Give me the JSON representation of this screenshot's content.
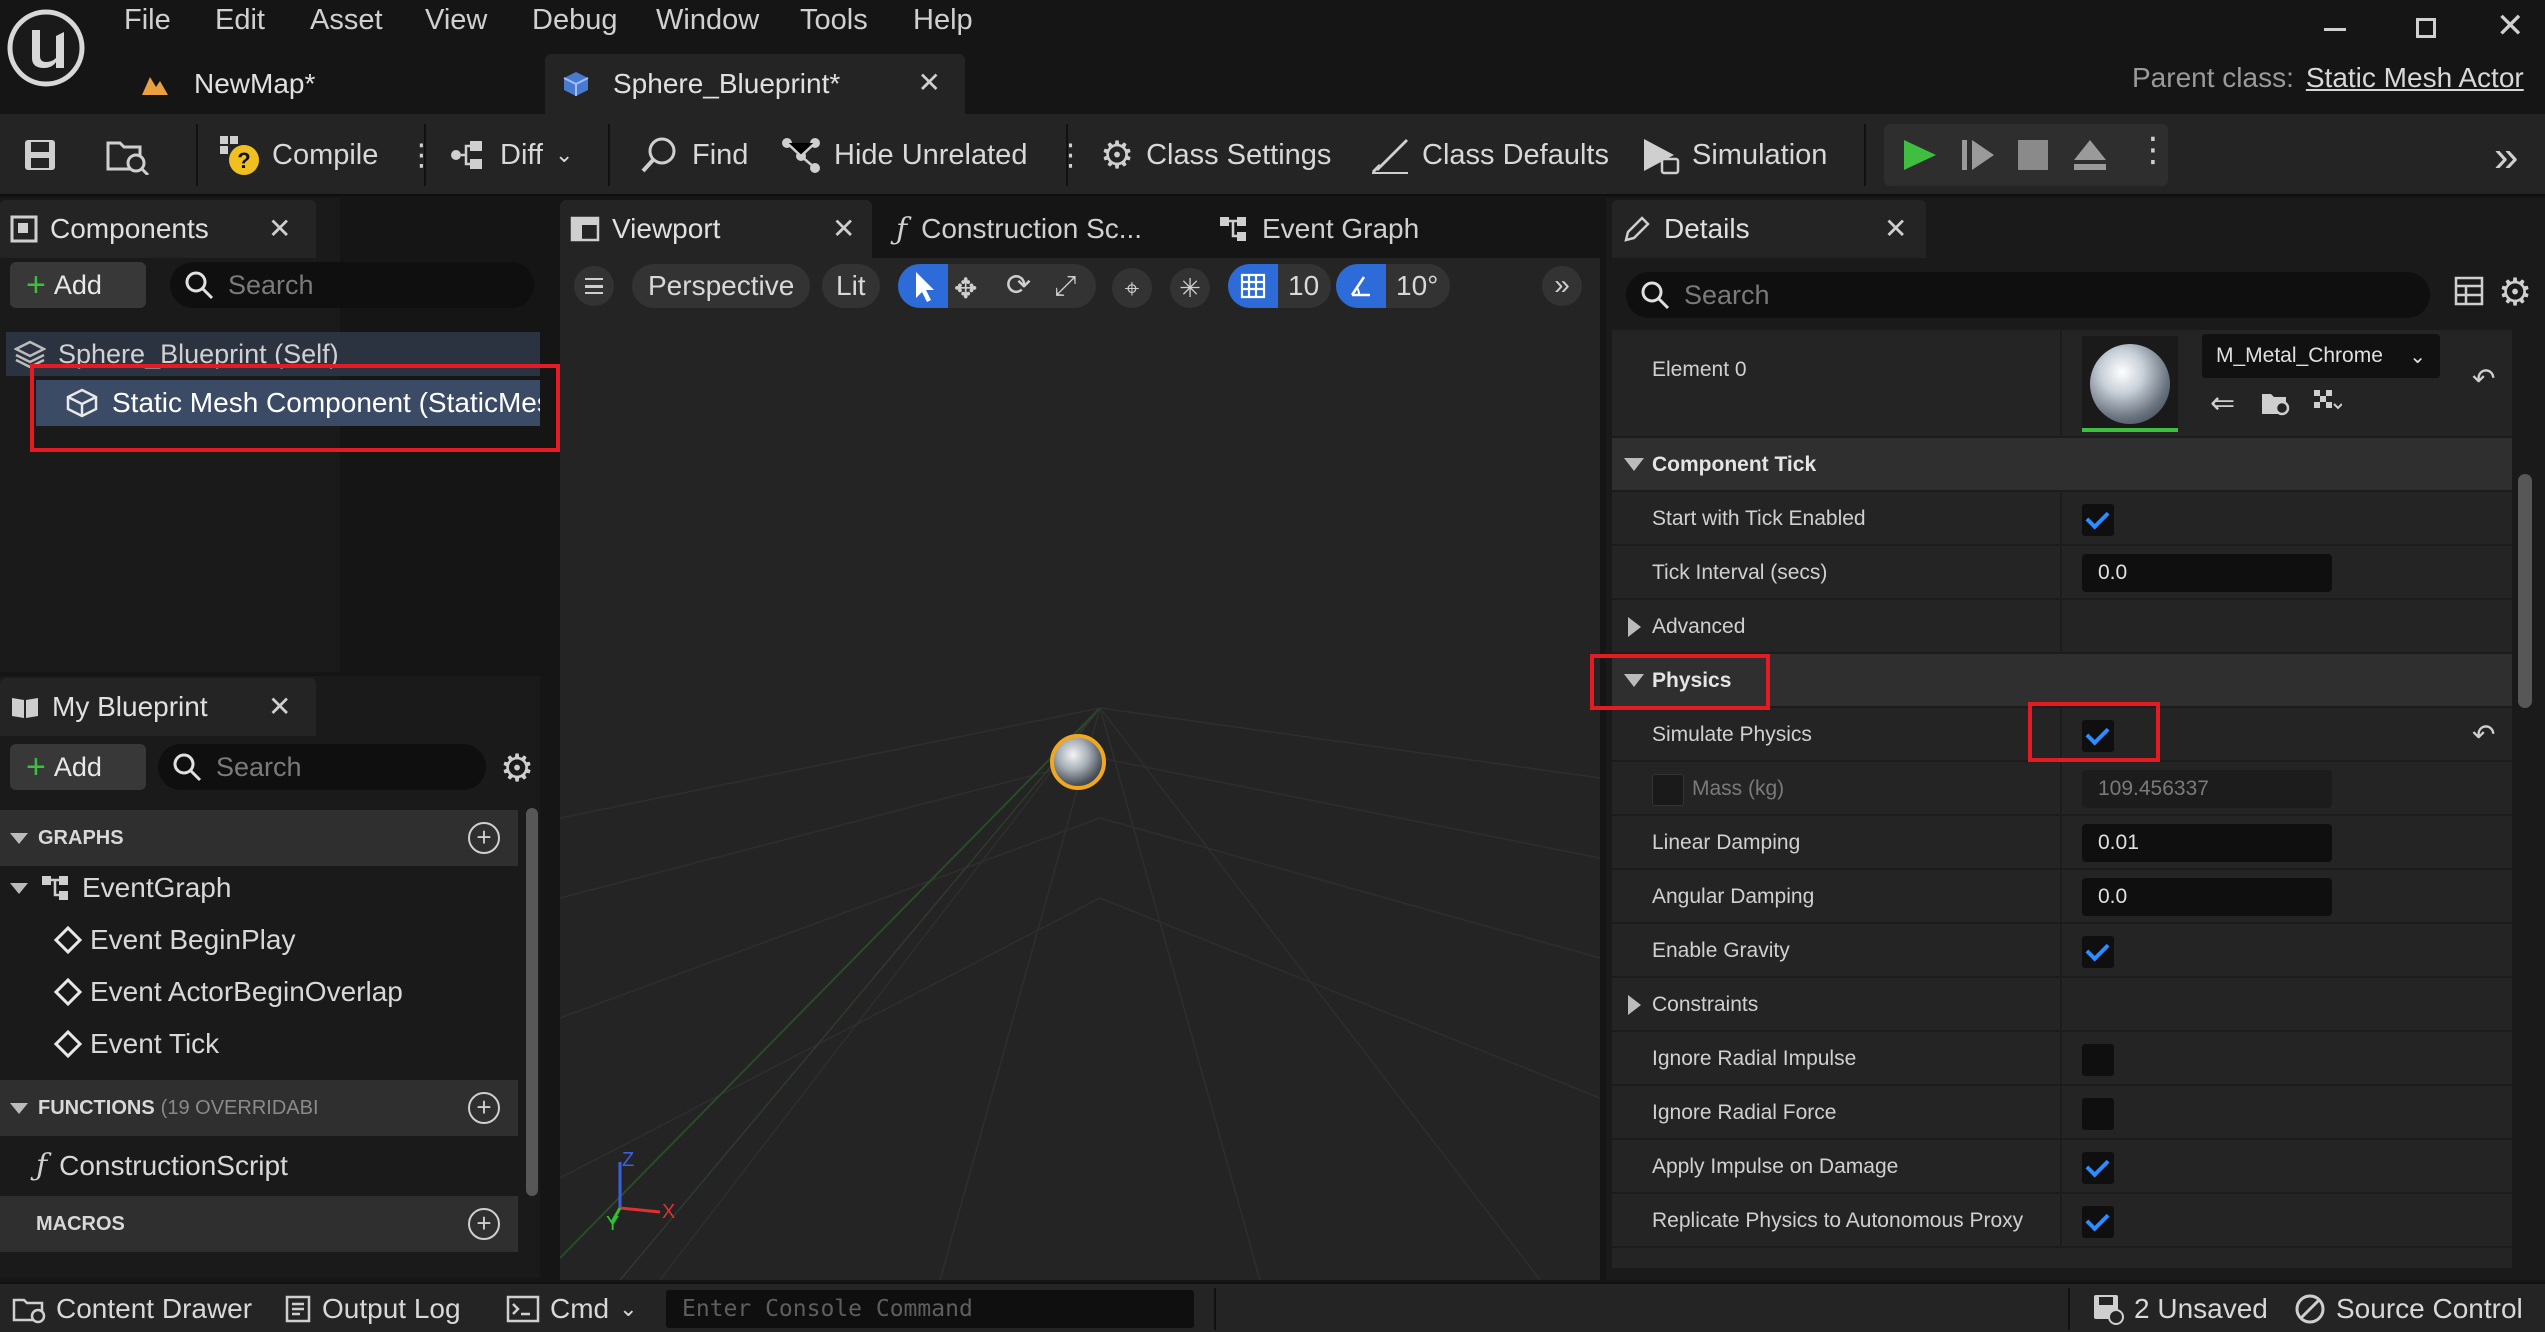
{
  "menu": [
    "File",
    "Edit",
    "Asset",
    "View",
    "Debug",
    "Window",
    "Tools",
    "Help"
  ],
  "doc_tabs": {
    "newmap": "NewMap*",
    "sphere": "Sphere_Blueprint*"
  },
  "parent_class": {
    "label": "Parent class:",
    "value": "Static Mesh Actor"
  },
  "toolbar": {
    "compile": "Compile",
    "diff": "Diff",
    "find": "Find",
    "hide_unrelated": "Hide Unrelated",
    "class_settings": "Class Settings",
    "class_defaults": "Class Defaults",
    "simulation": "Simulation"
  },
  "components": {
    "tab": "Components",
    "add": "Add",
    "search_placeholder": "Search",
    "items": [
      "Sphere_Blueprint (Self)",
      "Static Mesh Component (StaticMes"
    ]
  },
  "my_blueprint": {
    "tab": "My Blueprint",
    "add": "Add",
    "search_placeholder": "Search",
    "graphs_header": "GRAPHS",
    "event_graph": "EventGraph",
    "events": [
      "Event BeginPlay",
      "Event ActorBeginOverlap",
      "Event Tick"
    ],
    "functions_header": "FUNCTIONS",
    "functions_count": "(19 OVERRIDABI",
    "construction_script": "ConstructionScript",
    "macros_header": "MACROS"
  },
  "editor_tabs": {
    "viewport": "Viewport",
    "construction": "Construction Sc...",
    "event_graph": "Event Graph"
  },
  "viewport": {
    "perspective": "Perspective",
    "lit": "Lit",
    "grid_size": "10",
    "rot_snap": "10°"
  },
  "details": {
    "tab": "Details",
    "search_placeholder": "Search",
    "element0_label": "Element 0",
    "material": "M_Metal_Chrome",
    "component_tick": "Component Tick",
    "start_tick": "Start with Tick Enabled",
    "tick_interval": "Tick Interval (secs)",
    "tick_interval_value": "0.0",
    "advanced": "Advanced",
    "physics": "Physics",
    "simulate_physics": "Simulate Physics",
    "mass": "Mass (kg)",
    "mass_value": "109.456337",
    "linear_damping": "Linear Damping",
    "linear_damping_value": "0.01",
    "angular_damping": "Angular Damping",
    "angular_damping_value": "0.0",
    "enable_gravity": "Enable Gravity",
    "constraints": "Constraints",
    "ignore_radial_impulse": "Ignore Radial Impulse",
    "ignore_radial_force": "Ignore Radial Force",
    "apply_impulse": "Apply Impulse on Damage",
    "replicate_physics": "Replicate Physics to Autonomous Proxy"
  },
  "statusbar": {
    "content_drawer": "Content Drawer",
    "output_log": "Output Log",
    "cmd": "Cmd",
    "console_placeholder": "Enter Console Command",
    "unsaved": "2 Unsaved",
    "source_control": "Source Control"
  },
  "colors": {
    "accent_blue": "#2d8cff",
    "play_green": "#3fbf3f",
    "highlight_red": "#e51b23",
    "selection": "#3b4b66"
  }
}
